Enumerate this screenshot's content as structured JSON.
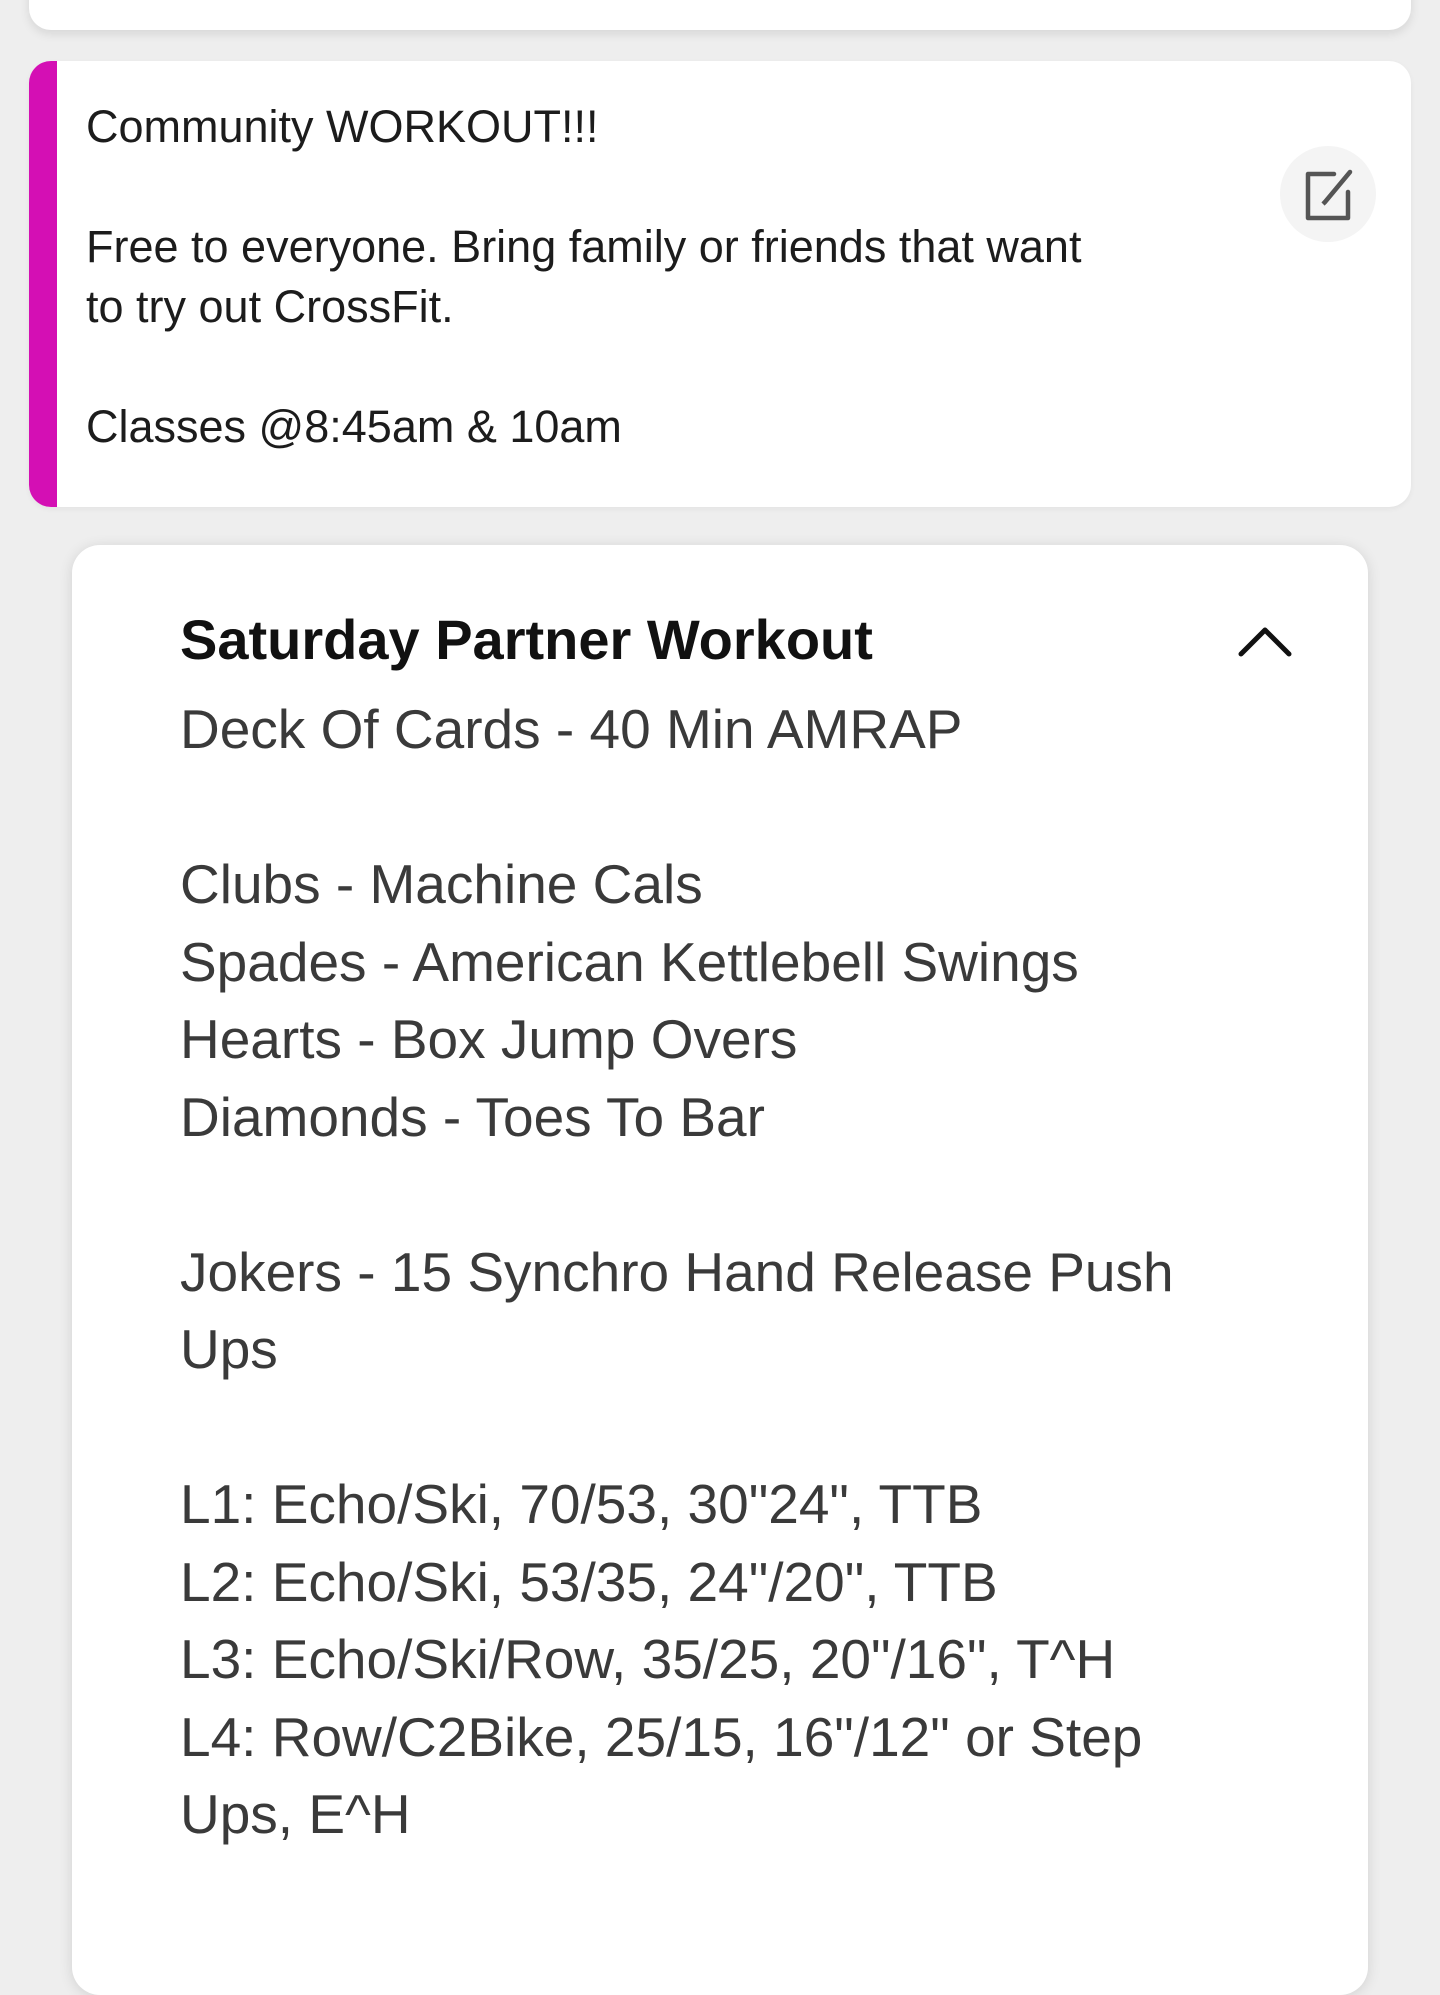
{
  "note": {
    "text": "Community WORKOUT!!!\n\nFree to everyone. Bring family or friends that want\nto try out CrossFit.\n\nClasses @8:45am & 10am",
    "accent_color": "#d40fb4",
    "edit_icon": "edit-icon"
  },
  "workout": {
    "title": "Saturday Partner Workout",
    "collapse_icon": "chevron-up-icon",
    "lines": [
      "Deck Of Cards - 40 Min AMRAP",
      "",
      "Clubs - Machine Cals",
      "Spades - American Kettlebell Swings",
      "Hearts - Box Jump Overs",
      "Diamonds - Toes To Bar",
      "",
      "Jokers - 15 Synchro Hand Release Push",
      "Ups",
      "",
      "L1: Echo/Ski, 70/53, 30\"24\", TTB",
      "L2: Echo/Ski, 53/35, 24\"/20\", TTB",
      "L3: Echo/Ski/Row, 35/25, 20\"/16\", T^H",
      "L4: Row/C2Bike, 25/15, 16\"/12\" or Step",
      "Ups, E^H"
    ]
  }
}
